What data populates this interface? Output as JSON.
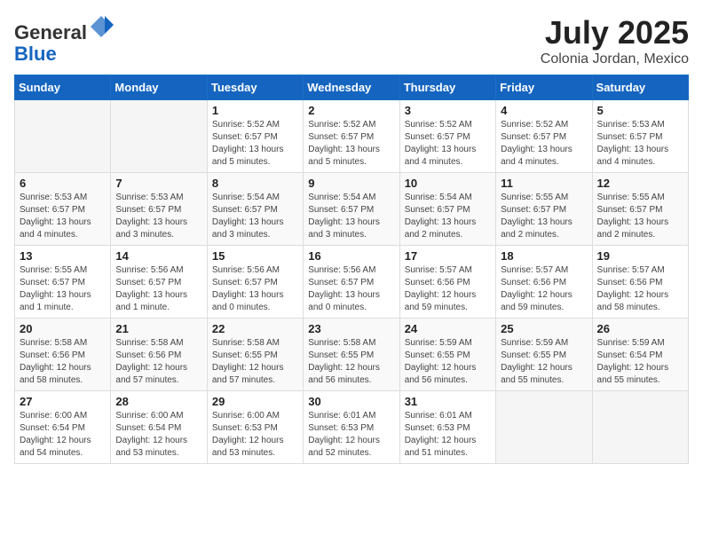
{
  "header": {
    "logo_line1": "General",
    "logo_line2": "Blue",
    "month": "July 2025",
    "location": "Colonia Jordan, Mexico"
  },
  "weekdays": [
    "Sunday",
    "Monday",
    "Tuesday",
    "Wednesday",
    "Thursday",
    "Friday",
    "Saturday"
  ],
  "weeks": [
    [
      {
        "day": "",
        "info": ""
      },
      {
        "day": "",
        "info": ""
      },
      {
        "day": "1",
        "info": "Sunrise: 5:52 AM\nSunset: 6:57 PM\nDaylight: 13 hours and 5 minutes."
      },
      {
        "day": "2",
        "info": "Sunrise: 5:52 AM\nSunset: 6:57 PM\nDaylight: 13 hours and 5 minutes."
      },
      {
        "day": "3",
        "info": "Sunrise: 5:52 AM\nSunset: 6:57 PM\nDaylight: 13 hours and 4 minutes."
      },
      {
        "day": "4",
        "info": "Sunrise: 5:52 AM\nSunset: 6:57 PM\nDaylight: 13 hours and 4 minutes."
      },
      {
        "day": "5",
        "info": "Sunrise: 5:53 AM\nSunset: 6:57 PM\nDaylight: 13 hours and 4 minutes."
      }
    ],
    [
      {
        "day": "6",
        "info": "Sunrise: 5:53 AM\nSunset: 6:57 PM\nDaylight: 13 hours and 4 minutes."
      },
      {
        "day": "7",
        "info": "Sunrise: 5:53 AM\nSunset: 6:57 PM\nDaylight: 13 hours and 3 minutes."
      },
      {
        "day": "8",
        "info": "Sunrise: 5:54 AM\nSunset: 6:57 PM\nDaylight: 13 hours and 3 minutes."
      },
      {
        "day": "9",
        "info": "Sunrise: 5:54 AM\nSunset: 6:57 PM\nDaylight: 13 hours and 3 minutes."
      },
      {
        "day": "10",
        "info": "Sunrise: 5:54 AM\nSunset: 6:57 PM\nDaylight: 13 hours and 2 minutes."
      },
      {
        "day": "11",
        "info": "Sunrise: 5:55 AM\nSunset: 6:57 PM\nDaylight: 13 hours and 2 minutes."
      },
      {
        "day": "12",
        "info": "Sunrise: 5:55 AM\nSunset: 6:57 PM\nDaylight: 13 hours and 2 minutes."
      }
    ],
    [
      {
        "day": "13",
        "info": "Sunrise: 5:55 AM\nSunset: 6:57 PM\nDaylight: 13 hours and 1 minute."
      },
      {
        "day": "14",
        "info": "Sunrise: 5:56 AM\nSunset: 6:57 PM\nDaylight: 13 hours and 1 minute."
      },
      {
        "day": "15",
        "info": "Sunrise: 5:56 AM\nSunset: 6:57 PM\nDaylight: 13 hours and 0 minutes."
      },
      {
        "day": "16",
        "info": "Sunrise: 5:56 AM\nSunset: 6:57 PM\nDaylight: 13 hours and 0 minutes."
      },
      {
        "day": "17",
        "info": "Sunrise: 5:57 AM\nSunset: 6:56 PM\nDaylight: 12 hours and 59 minutes."
      },
      {
        "day": "18",
        "info": "Sunrise: 5:57 AM\nSunset: 6:56 PM\nDaylight: 12 hours and 59 minutes."
      },
      {
        "day": "19",
        "info": "Sunrise: 5:57 AM\nSunset: 6:56 PM\nDaylight: 12 hours and 58 minutes."
      }
    ],
    [
      {
        "day": "20",
        "info": "Sunrise: 5:58 AM\nSunset: 6:56 PM\nDaylight: 12 hours and 58 minutes."
      },
      {
        "day": "21",
        "info": "Sunrise: 5:58 AM\nSunset: 6:56 PM\nDaylight: 12 hours and 57 minutes."
      },
      {
        "day": "22",
        "info": "Sunrise: 5:58 AM\nSunset: 6:55 PM\nDaylight: 12 hours and 57 minutes."
      },
      {
        "day": "23",
        "info": "Sunrise: 5:58 AM\nSunset: 6:55 PM\nDaylight: 12 hours and 56 minutes."
      },
      {
        "day": "24",
        "info": "Sunrise: 5:59 AM\nSunset: 6:55 PM\nDaylight: 12 hours and 56 minutes."
      },
      {
        "day": "25",
        "info": "Sunrise: 5:59 AM\nSunset: 6:55 PM\nDaylight: 12 hours and 55 minutes."
      },
      {
        "day": "26",
        "info": "Sunrise: 5:59 AM\nSunset: 6:54 PM\nDaylight: 12 hours and 55 minutes."
      }
    ],
    [
      {
        "day": "27",
        "info": "Sunrise: 6:00 AM\nSunset: 6:54 PM\nDaylight: 12 hours and 54 minutes."
      },
      {
        "day": "28",
        "info": "Sunrise: 6:00 AM\nSunset: 6:54 PM\nDaylight: 12 hours and 53 minutes."
      },
      {
        "day": "29",
        "info": "Sunrise: 6:00 AM\nSunset: 6:53 PM\nDaylight: 12 hours and 53 minutes."
      },
      {
        "day": "30",
        "info": "Sunrise: 6:01 AM\nSunset: 6:53 PM\nDaylight: 12 hours and 52 minutes."
      },
      {
        "day": "31",
        "info": "Sunrise: 6:01 AM\nSunset: 6:53 PM\nDaylight: 12 hours and 51 minutes."
      },
      {
        "day": "",
        "info": ""
      },
      {
        "day": "",
        "info": ""
      }
    ]
  ]
}
